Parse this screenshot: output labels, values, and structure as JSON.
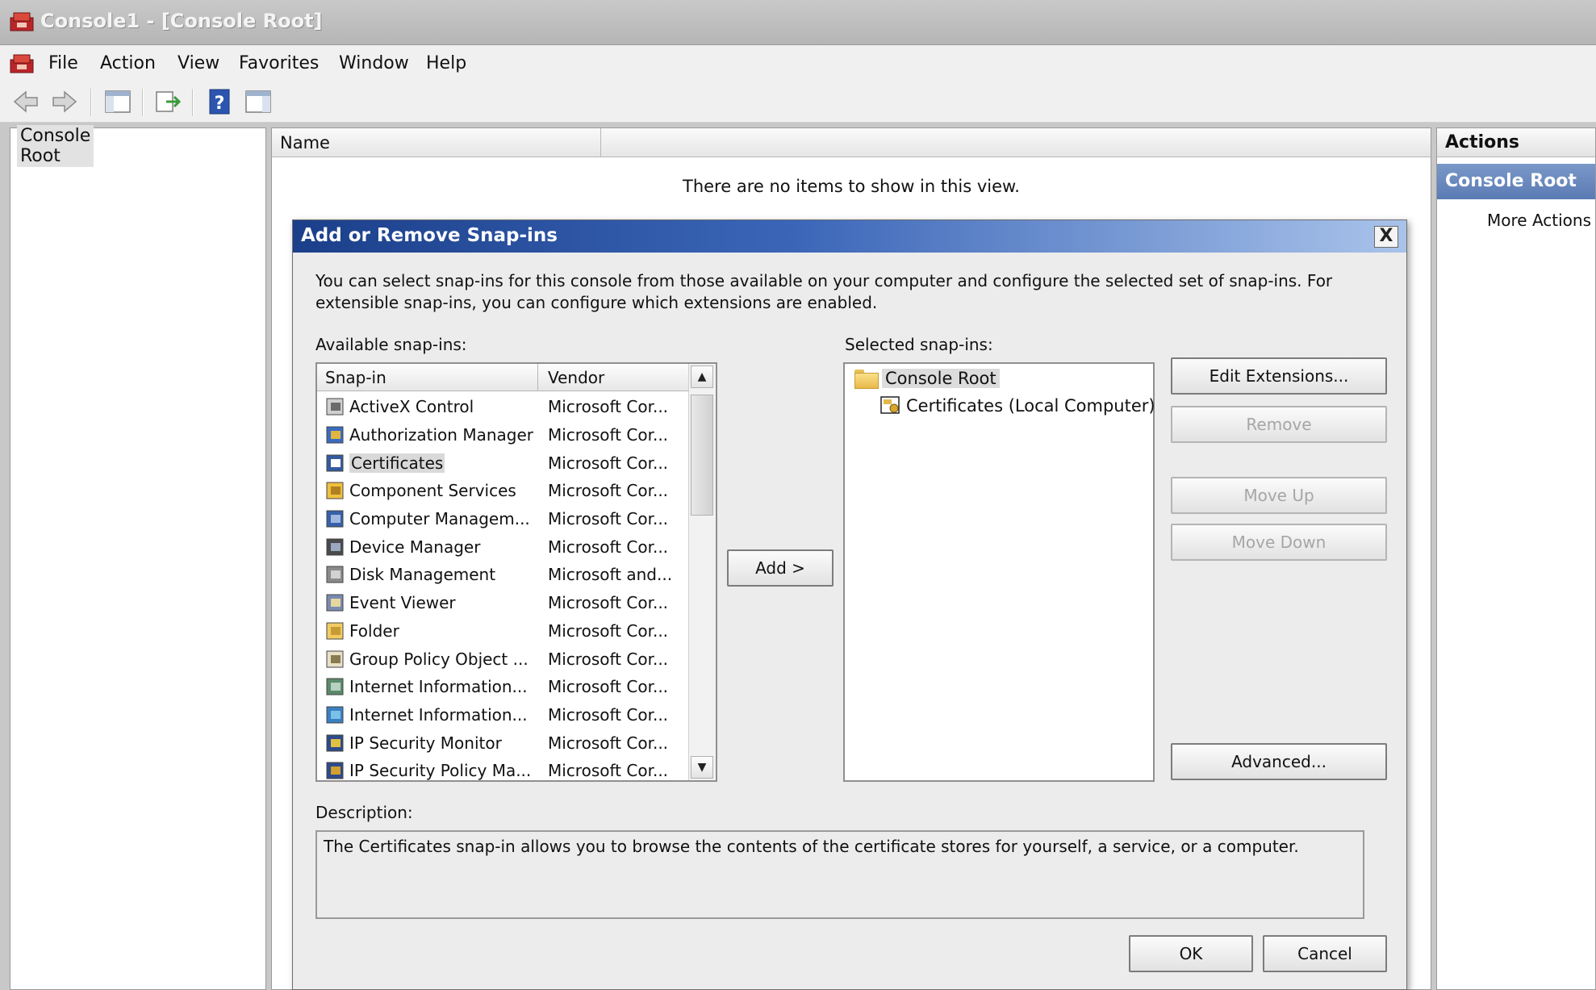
{
  "window": {
    "title": "Console1 - [Console Root]"
  },
  "menu": [
    "File",
    "Action",
    "View",
    "Favorites",
    "Window",
    "Help"
  ],
  "toolbar": {
    "icons": [
      "back-icon",
      "forward-icon",
      "show-hide-tree-icon",
      "export-list-icon",
      "help-icon",
      "show-hide-action-pane-icon"
    ]
  },
  "tree": {
    "root_label": "Console Root"
  },
  "center": {
    "column_name": "Name",
    "empty_message": "There are no items to show in this view."
  },
  "actions": {
    "header": "Actions",
    "section": "Console Root",
    "more": "More Actions"
  },
  "dialog": {
    "title": "Add or Remove Snap-ins",
    "close": "X",
    "intro": "You can select snap-ins for this console from those available on your computer and configure the selected set of snap-ins. For extensible snap-ins, you can configure which extensions are enabled.",
    "available_label": "Available snap-ins:",
    "selected_label": "Selected snap-ins:",
    "columns": {
      "snapin": "Snap-in",
      "vendor": "Vendor"
    },
    "available": [
      {
        "name": "ActiveX Control",
        "vendor": "Microsoft Cor...",
        "icon": "activex-icon"
      },
      {
        "name": "Authorization Manager",
        "vendor": "Microsoft Cor...",
        "icon": "authorization-manager-icon"
      },
      {
        "name": "Certificates",
        "vendor": "Microsoft Cor...",
        "icon": "certificates-icon",
        "selected": true
      },
      {
        "name": "Component Services",
        "vendor": "Microsoft Cor...",
        "icon": "component-services-icon"
      },
      {
        "name": "Computer Managem...",
        "vendor": "Microsoft Cor...",
        "icon": "computer-management-icon"
      },
      {
        "name": "Device Manager",
        "vendor": "Microsoft Cor...",
        "icon": "device-manager-icon"
      },
      {
        "name": "Disk Management",
        "vendor": "Microsoft and...",
        "icon": "disk-management-icon"
      },
      {
        "name": "Event Viewer",
        "vendor": "Microsoft Cor...",
        "icon": "event-viewer-icon"
      },
      {
        "name": "Folder",
        "vendor": "Microsoft Cor...",
        "icon": "folder-icon"
      },
      {
        "name": "Group Policy Object ...",
        "vendor": "Microsoft Cor...",
        "icon": "group-policy-icon"
      },
      {
        "name": "Internet Information...",
        "vendor": "Microsoft Cor...",
        "icon": "iis-icon"
      },
      {
        "name": "Internet Information...",
        "vendor": "Microsoft Cor...",
        "icon": "iis-globe-icon"
      },
      {
        "name": "IP Security Monitor",
        "vendor": "Microsoft Cor...",
        "icon": "ip-security-monitor-icon"
      },
      {
        "name": "IP Security Policy Ma...",
        "vendor": "Microsoft Cor...",
        "icon": "ip-security-policy-icon"
      }
    ],
    "add_button": "Add >",
    "selected_tree": {
      "root": "Console Root",
      "child": "Certificates (Local Computer)"
    },
    "buttons": {
      "edit_extensions": "Edit Extensions...",
      "remove": "Remove",
      "move_up": "Move Up",
      "move_down": "Move Down",
      "advanced": "Advanced...",
      "ok": "OK",
      "cancel": "Cancel"
    },
    "description_label": "Description:",
    "description": "The Certificates snap-in allows you to browse the contents of the certificate stores for yourself, a service, or a computer."
  }
}
